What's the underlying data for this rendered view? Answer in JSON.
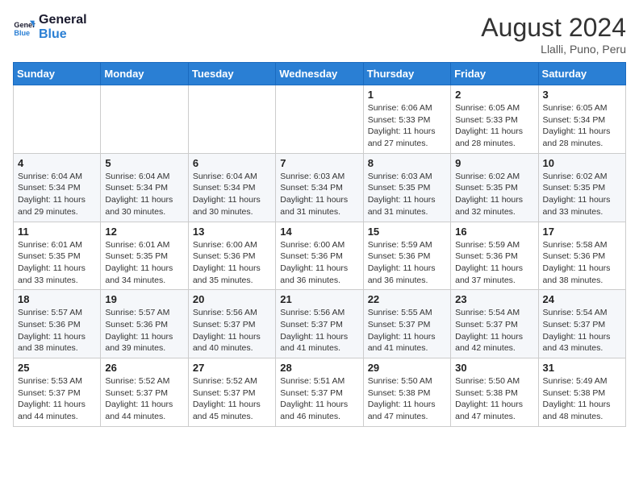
{
  "header": {
    "logo_general": "General",
    "logo_blue": "Blue",
    "month_year": "August 2024",
    "location": "Llalli, Puno, Peru"
  },
  "days_of_week": [
    "Sunday",
    "Monday",
    "Tuesday",
    "Wednesday",
    "Thursday",
    "Friday",
    "Saturday"
  ],
  "weeks": [
    [
      {
        "day": "",
        "info": ""
      },
      {
        "day": "",
        "info": ""
      },
      {
        "day": "",
        "info": ""
      },
      {
        "day": "",
        "info": ""
      },
      {
        "day": "1",
        "info": "Sunrise: 6:06 AM\nSunset: 5:33 PM\nDaylight: 11 hours and 27 minutes."
      },
      {
        "day": "2",
        "info": "Sunrise: 6:05 AM\nSunset: 5:33 PM\nDaylight: 11 hours and 28 minutes."
      },
      {
        "day": "3",
        "info": "Sunrise: 6:05 AM\nSunset: 5:34 PM\nDaylight: 11 hours and 28 minutes."
      }
    ],
    [
      {
        "day": "4",
        "info": "Sunrise: 6:04 AM\nSunset: 5:34 PM\nDaylight: 11 hours and 29 minutes."
      },
      {
        "day": "5",
        "info": "Sunrise: 6:04 AM\nSunset: 5:34 PM\nDaylight: 11 hours and 30 minutes."
      },
      {
        "day": "6",
        "info": "Sunrise: 6:04 AM\nSunset: 5:34 PM\nDaylight: 11 hours and 30 minutes."
      },
      {
        "day": "7",
        "info": "Sunrise: 6:03 AM\nSunset: 5:34 PM\nDaylight: 11 hours and 31 minutes."
      },
      {
        "day": "8",
        "info": "Sunrise: 6:03 AM\nSunset: 5:35 PM\nDaylight: 11 hours and 31 minutes."
      },
      {
        "day": "9",
        "info": "Sunrise: 6:02 AM\nSunset: 5:35 PM\nDaylight: 11 hours and 32 minutes."
      },
      {
        "day": "10",
        "info": "Sunrise: 6:02 AM\nSunset: 5:35 PM\nDaylight: 11 hours and 33 minutes."
      }
    ],
    [
      {
        "day": "11",
        "info": "Sunrise: 6:01 AM\nSunset: 5:35 PM\nDaylight: 11 hours and 33 minutes."
      },
      {
        "day": "12",
        "info": "Sunrise: 6:01 AM\nSunset: 5:35 PM\nDaylight: 11 hours and 34 minutes."
      },
      {
        "day": "13",
        "info": "Sunrise: 6:00 AM\nSunset: 5:36 PM\nDaylight: 11 hours and 35 minutes."
      },
      {
        "day": "14",
        "info": "Sunrise: 6:00 AM\nSunset: 5:36 PM\nDaylight: 11 hours and 36 minutes."
      },
      {
        "day": "15",
        "info": "Sunrise: 5:59 AM\nSunset: 5:36 PM\nDaylight: 11 hours and 36 minutes."
      },
      {
        "day": "16",
        "info": "Sunrise: 5:59 AM\nSunset: 5:36 PM\nDaylight: 11 hours and 37 minutes."
      },
      {
        "day": "17",
        "info": "Sunrise: 5:58 AM\nSunset: 5:36 PM\nDaylight: 11 hours and 38 minutes."
      }
    ],
    [
      {
        "day": "18",
        "info": "Sunrise: 5:57 AM\nSunset: 5:36 PM\nDaylight: 11 hours and 38 minutes."
      },
      {
        "day": "19",
        "info": "Sunrise: 5:57 AM\nSunset: 5:36 PM\nDaylight: 11 hours and 39 minutes."
      },
      {
        "day": "20",
        "info": "Sunrise: 5:56 AM\nSunset: 5:37 PM\nDaylight: 11 hours and 40 minutes."
      },
      {
        "day": "21",
        "info": "Sunrise: 5:56 AM\nSunset: 5:37 PM\nDaylight: 11 hours and 41 minutes."
      },
      {
        "day": "22",
        "info": "Sunrise: 5:55 AM\nSunset: 5:37 PM\nDaylight: 11 hours and 41 minutes."
      },
      {
        "day": "23",
        "info": "Sunrise: 5:54 AM\nSunset: 5:37 PM\nDaylight: 11 hours and 42 minutes."
      },
      {
        "day": "24",
        "info": "Sunrise: 5:54 AM\nSunset: 5:37 PM\nDaylight: 11 hours and 43 minutes."
      }
    ],
    [
      {
        "day": "25",
        "info": "Sunrise: 5:53 AM\nSunset: 5:37 PM\nDaylight: 11 hours and 44 minutes."
      },
      {
        "day": "26",
        "info": "Sunrise: 5:52 AM\nSunset: 5:37 PM\nDaylight: 11 hours and 44 minutes."
      },
      {
        "day": "27",
        "info": "Sunrise: 5:52 AM\nSunset: 5:37 PM\nDaylight: 11 hours and 45 minutes."
      },
      {
        "day": "28",
        "info": "Sunrise: 5:51 AM\nSunset: 5:37 PM\nDaylight: 11 hours and 46 minutes."
      },
      {
        "day": "29",
        "info": "Sunrise: 5:50 AM\nSunset: 5:38 PM\nDaylight: 11 hours and 47 minutes."
      },
      {
        "day": "30",
        "info": "Sunrise: 5:50 AM\nSunset: 5:38 PM\nDaylight: 11 hours and 47 minutes."
      },
      {
        "day": "31",
        "info": "Sunrise: 5:49 AM\nSunset: 5:38 PM\nDaylight: 11 hours and 48 minutes."
      }
    ]
  ]
}
